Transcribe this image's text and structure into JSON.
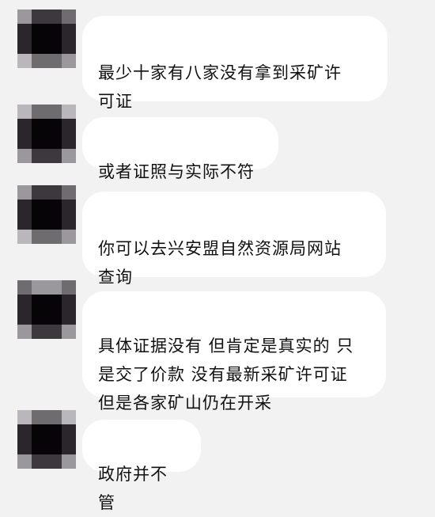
{
  "messages": [
    {
      "text": "最少十家有八家没有拿到采矿许\n可证"
    },
    {
      "text": "或者证照与实际不符"
    },
    {
      "text": "你可以去兴安盟自然资源局网站\n查询"
    },
    {
      "text": "具体证据没有 但肯定是真实的 只\n是交了价款 没有最新采矿许可证\n但是各家矿山仍在开采"
    },
    {
      "text": "政府并不管"
    }
  ]
}
